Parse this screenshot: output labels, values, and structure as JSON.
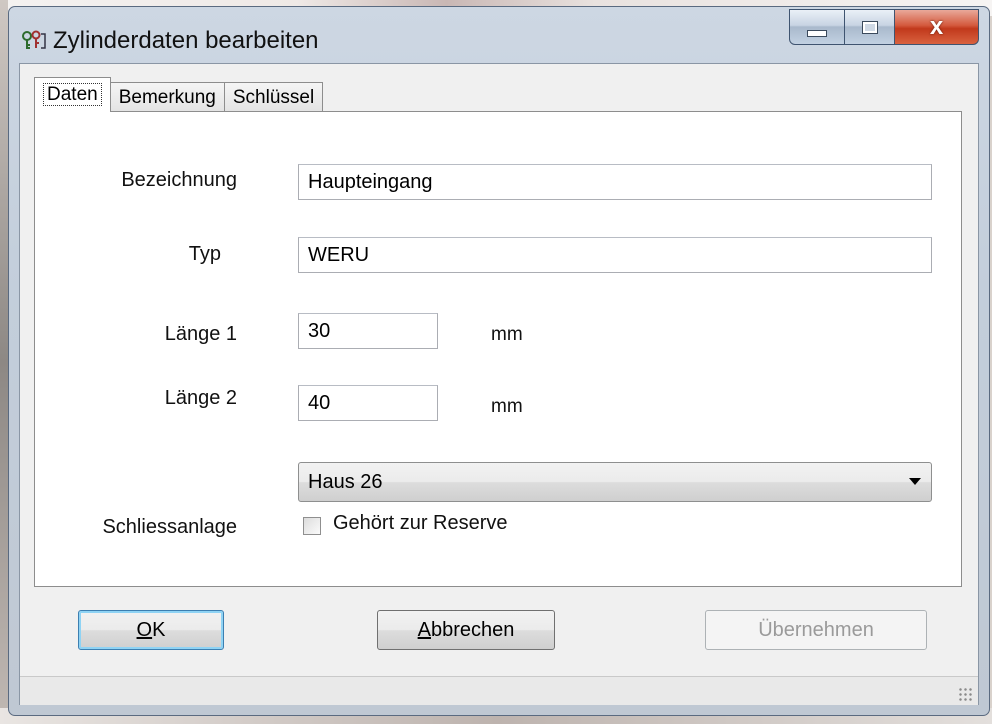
{
  "window": {
    "title": "Zylinderdaten bearbeiten",
    "close_glyph": "x"
  },
  "tabs": [
    {
      "label": "Daten",
      "active": true
    },
    {
      "label": "Bemerkung",
      "active": false
    },
    {
      "label": "Schlüssel",
      "active": false
    }
  ],
  "form": {
    "bezeichnung_label": "Bezeichnung",
    "bezeichnung_value": "Haupteingang",
    "typ_label": "Typ",
    "typ_value": "WERU",
    "laenge1_label": "Länge 1",
    "laenge1_value": "30",
    "laenge1_unit": "mm",
    "laenge2_label": "Länge 2",
    "laenge2_value": "40",
    "laenge2_unit": "mm",
    "schliessanlage_label": "Schliessanlage",
    "schliessanlage_value": "Haus 26",
    "reserve_label": "Gehört zur Reserve",
    "reserve_checked": false
  },
  "buttons": {
    "ok_mnemonic": "O",
    "ok_rest": "K",
    "cancel_mnemonic": "A",
    "cancel_rest": "bbrechen",
    "apply_label": "Übernehmen",
    "apply_enabled": false
  },
  "icons": {
    "app": "keys-icon",
    "minimize": "minimize-icon",
    "maximize": "maximize-icon",
    "close": "close-icon",
    "dropdown": "chevron-down-icon",
    "grip": "resize-grip-icon"
  }
}
